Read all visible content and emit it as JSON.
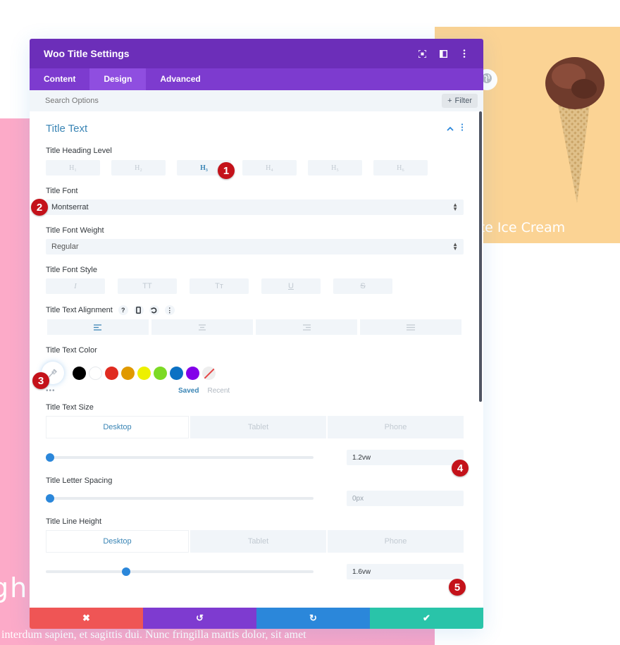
{
  "background": {
    "pink_heading_fragment": "gh",
    "lorem_line": "interdum sapien, et sagittis dui. Nunc fringilla mattis dolor, sit amet",
    "card_title_fragment": "ate Ice Cream",
    "card_image": "ice-cream-cone",
    "colors": {
      "pink": "#fcaac8",
      "peach": "#fbd394"
    }
  },
  "modal": {
    "title": "Woo Title Settings",
    "header_icons": [
      "fullscreen-icon",
      "split-view-icon",
      "more-options-icon"
    ],
    "tabs": [
      {
        "label": "Content",
        "active": false
      },
      {
        "label": "Design",
        "active": true
      },
      {
        "label": "Advanced",
        "active": false
      }
    ],
    "search": {
      "placeholder": "Search Options",
      "filter_label": "Filter"
    },
    "section": {
      "title": "Title Text",
      "heading_level": {
        "label": "Title Heading Level",
        "options": [
          "H₁",
          "H₂",
          "H₃",
          "H₄",
          "H₅",
          "H₆"
        ],
        "selected": "H₃"
      },
      "font": {
        "label": "Title Font",
        "value": "Montserrat"
      },
      "font_weight": {
        "label": "Title Font Weight",
        "value": "Regular"
      },
      "font_style": {
        "label": "Title Font Style",
        "options": [
          "I",
          "TT",
          "Tт",
          "U",
          "S"
        ]
      },
      "alignment": {
        "label": "Title Text Alignment",
        "options": [
          "left",
          "center",
          "right",
          "justify"
        ],
        "selected": "left"
      },
      "text_color": {
        "label": "Title Text Color",
        "swatches": [
          "#000000",
          "#ffffff",
          "#e02b20",
          "#e09900",
          "#edf000",
          "#7cda24",
          "#0c71c3",
          "#8300e9"
        ],
        "saved_label": "Saved",
        "recent_label": "Recent",
        "more_label": "•••"
      },
      "text_size": {
        "label": "Title Text Size",
        "devices": [
          "Desktop",
          "Tablet",
          "Phone"
        ],
        "active_device": "Desktop",
        "value": "1.2vw",
        "slider_fraction": 0.0
      },
      "letter_spacing": {
        "label": "Title Letter Spacing",
        "placeholder": "0px",
        "slider_fraction": 0.0
      },
      "line_height": {
        "label": "Title Line Height",
        "devices": [
          "Desktop",
          "Tablet",
          "Phone"
        ],
        "active_device": "Desktop",
        "value": "1.6vw",
        "slider_fraction": 0.3
      }
    },
    "footer": {
      "buttons": [
        {
          "name": "cancel",
          "icon": "✖",
          "color": "#ef5555"
        },
        {
          "name": "undo",
          "icon": "↺",
          "color": "#7e3bd0"
        },
        {
          "name": "redo",
          "icon": "↻",
          "color": "#2b87da"
        },
        {
          "name": "save",
          "icon": "✔",
          "color": "#29c4a9"
        }
      ]
    },
    "annotations": [
      "1",
      "2",
      "3",
      "4",
      "5"
    ]
  }
}
